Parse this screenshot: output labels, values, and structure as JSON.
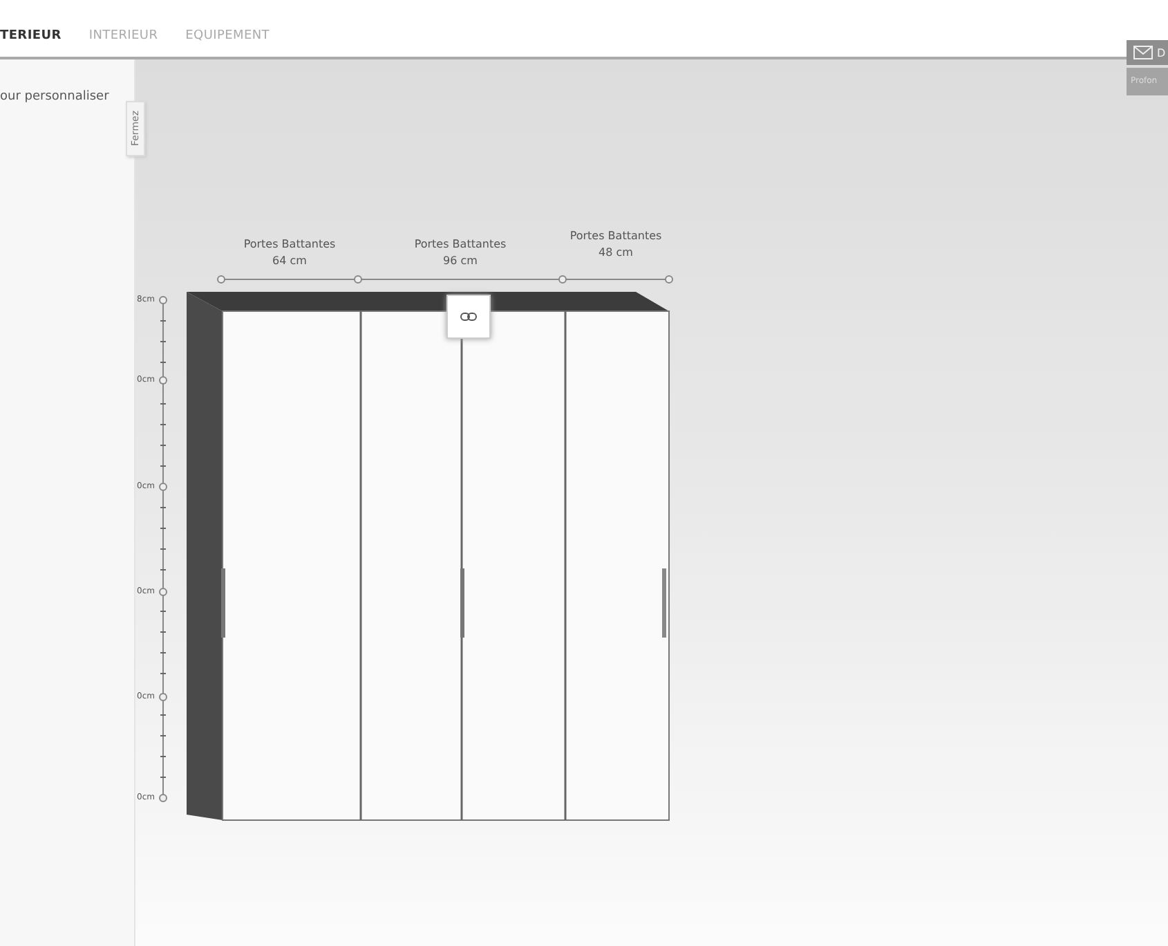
{
  "tabs": [
    {
      "label": "TERIEUR",
      "selected": true
    },
    {
      "label": "INTERIEUR",
      "selected": false
    },
    {
      "label": "EQUIPEMENT",
      "selected": false
    }
  ],
  "sidebar": {
    "text": "our personnaliser",
    "close_tab": "Fermez"
  },
  "contact": {
    "label": "D",
    "sublabel": "Profon"
  },
  "sections": [
    {
      "title": "Portes Battantes",
      "width": "64 cm"
    },
    {
      "title": "Portes Battantes",
      "width": "96 cm"
    },
    {
      "title": "Portes Battantes",
      "width": "48 cm"
    }
  ],
  "height_marks": [
    "8cm",
    "0cm",
    "0cm",
    "0cm",
    "0cm",
    "0cm"
  ]
}
